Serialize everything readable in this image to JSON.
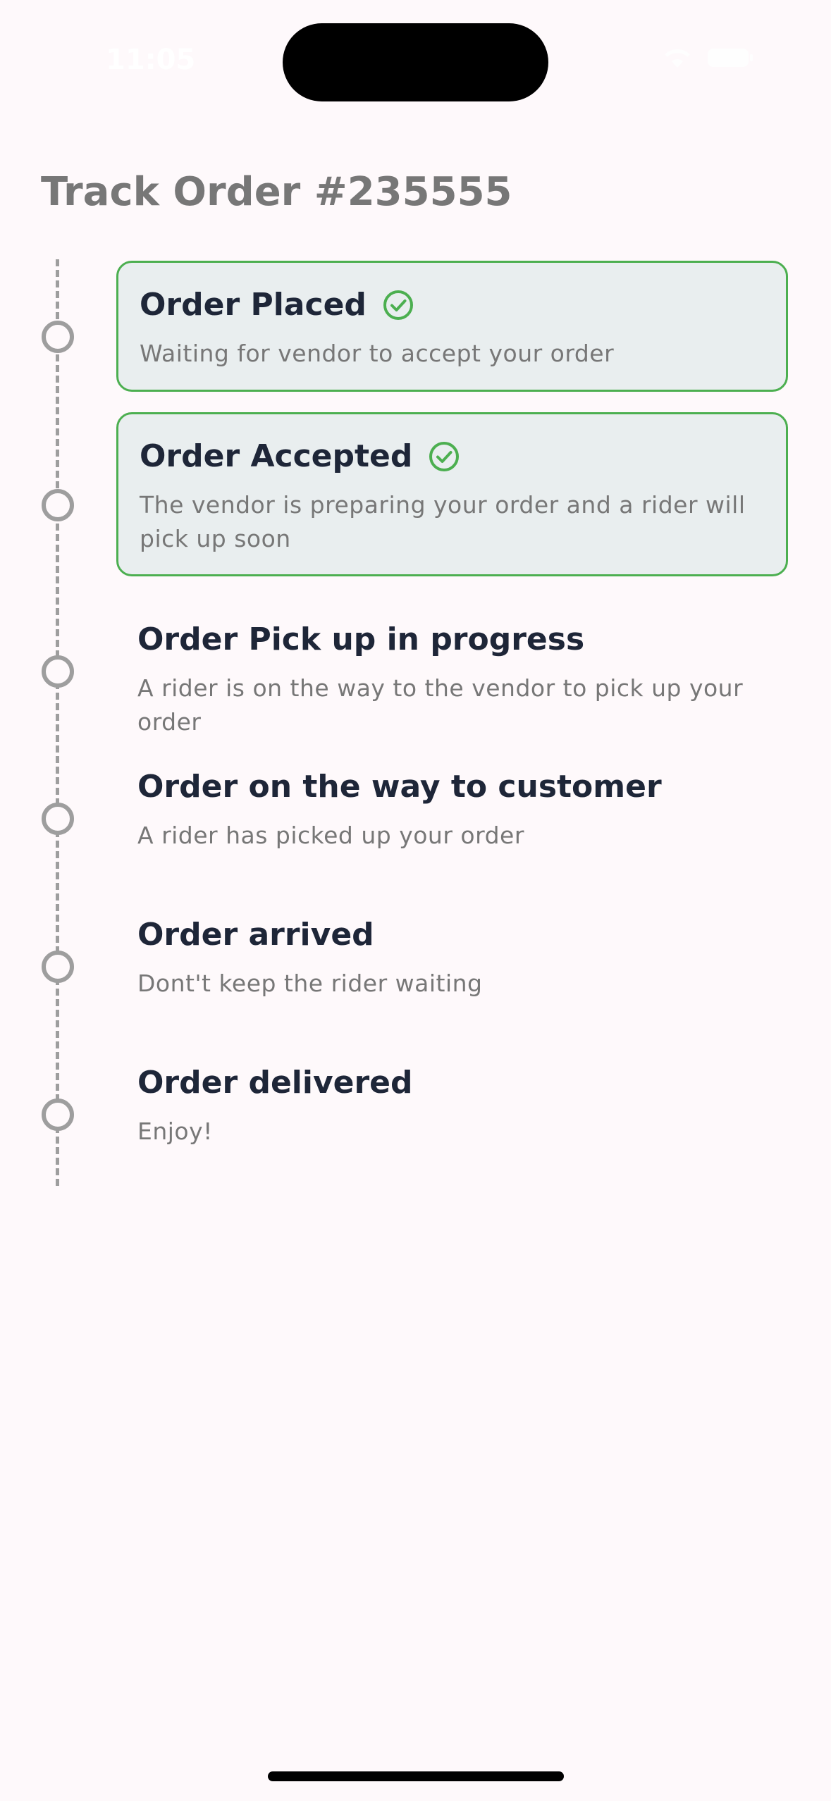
{
  "status_bar": {
    "time": "11:05"
  },
  "page": {
    "title": "Track Order #235555"
  },
  "colors": {
    "done_border": "#4CAF50",
    "done_background": "#E9EEEF",
    "timeline": "#9E9E9E",
    "title_text": "#1E2638",
    "muted_text": "#777777",
    "background": "#FEF9FB"
  },
  "steps": [
    {
      "title": "Order Placed",
      "description": "Waiting for vendor to accept your order",
      "completed": true,
      "icon": "check-circle-icon"
    },
    {
      "title": "Order Accepted",
      "description": "The vendor is preparing your order and a rider will pick up soon",
      "completed": true,
      "icon": "check-circle-icon"
    },
    {
      "title": "Order Pick up in progress",
      "description": "A rider is on the way to the vendor to pick up your order",
      "completed": false
    },
    {
      "title": "Order on the way to customer",
      "description": "A rider has picked up your order",
      "completed": false
    },
    {
      "title": "Order arrived",
      "description": "Dont't keep the rider waiting",
      "completed": false
    },
    {
      "title": "Order delivered",
      "description": "Enjoy!",
      "completed": false
    }
  ]
}
